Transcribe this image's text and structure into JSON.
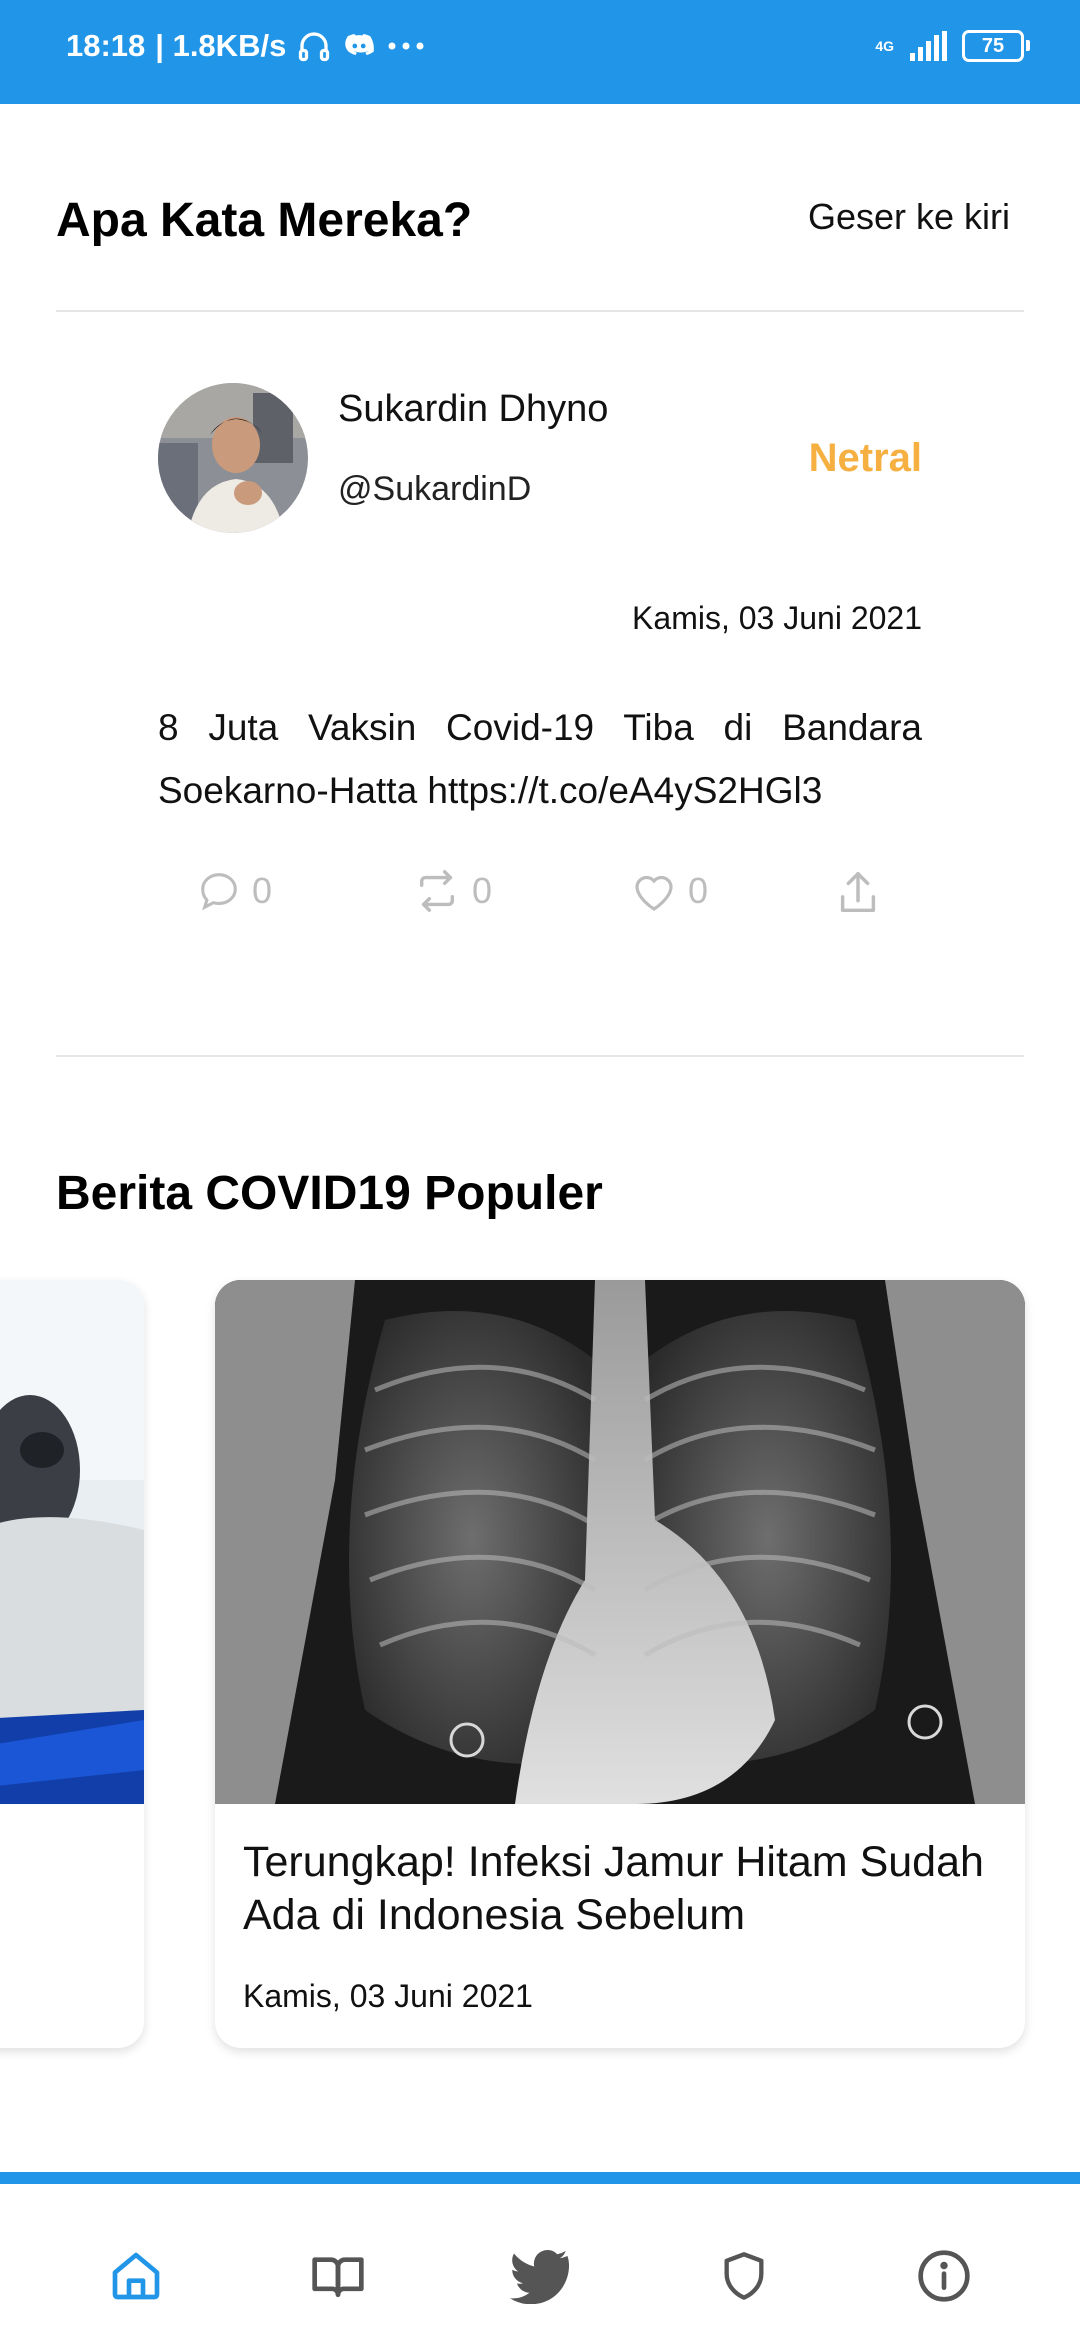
{
  "status_bar": {
    "time": "18:18",
    "speed": "| 1.8KB/s",
    "network": "4G",
    "battery": "75",
    "icons": [
      "headphones-icon",
      "discord-icon",
      "more-icon",
      "signal-icon",
      "battery-icon"
    ]
  },
  "opinions": {
    "title": "Apa Kata Mereka?",
    "hint": "Geser ke kiri",
    "tweet": {
      "name": "Sukardin Dhyno",
      "handle": "@SukardinD",
      "sentiment": "Netral",
      "sentiment_color": "#f5b041",
      "date": "Kamis, 03 Juni 2021",
      "text": "8 Juta Vaksin Covid-19 Tiba di Bandara Soekarno-Hatta https://t.co/eA4yS2HGl3",
      "replies": "0",
      "retweets": "0",
      "likes": "0"
    }
  },
  "news": {
    "title": "Berita COVID19 Populer",
    "cards": [
      {
        "title": "Terungkap! Infeksi Jamur Hitam Sudah Ada di Indonesia Sebelum",
        "date": "Kamis, 03 Juni 2021"
      }
    ]
  },
  "bottom_nav": {
    "accent": "#2196e8",
    "items": [
      "home-icon",
      "book-icon",
      "twitter-icon",
      "shield-icon",
      "info-icon"
    ],
    "active": "home-icon"
  }
}
